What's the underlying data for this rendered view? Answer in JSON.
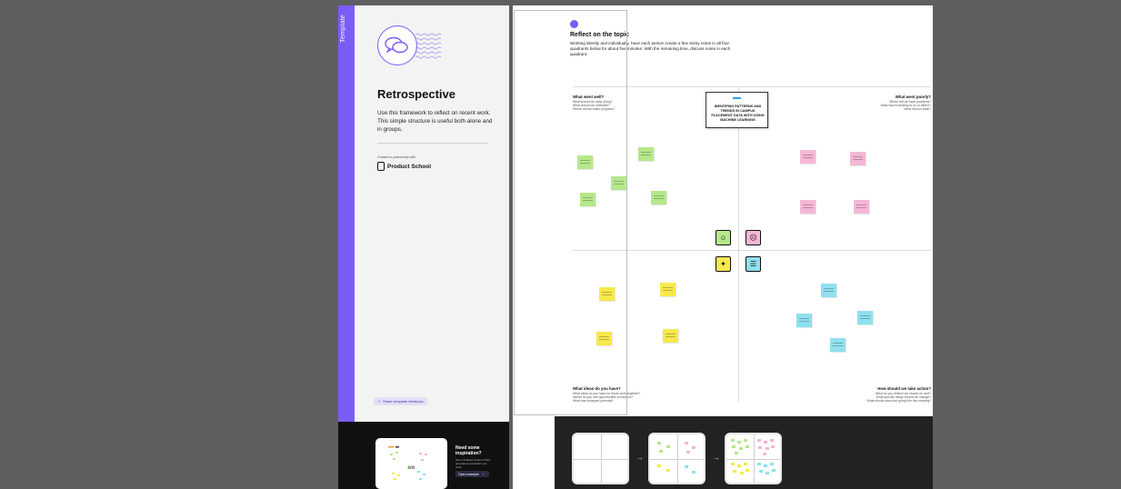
{
  "sidebar": {
    "tag": "Template",
    "title": "Retrospective",
    "description": "Use this framework to reflect on recent work. This simple structure is useful both alone and in groups.",
    "created_in_partnership": "Created in partnership with",
    "partner": "Product School",
    "feedback_label": "Share template feedback",
    "inspiration_title": "Need some inspiration?",
    "inspiration_desc": "See a finished version of this template to jumpstart your work",
    "open_example": "Open example"
  },
  "board": {
    "step_title": "Reflect on the topic",
    "step_desc": "Working silently and individually, have each person create a few sticky notes in all four quadrants below for about five minutes. With the remaining time, discuss notes in each quadrant.",
    "center_card": "IDENTIFING PATTERNS AND TRENDS IN CAMPUS PLACEMENT DATA WITH USING MACHINE LEARNING",
    "quadrants": {
      "went_well": {
        "title": "What went well?",
        "prompts": [
          "What should we keep doing?",
          "What should we celebrate?",
          "Where did we make progress?"
        ]
      },
      "went_poorly": {
        "title": "What went poorly?",
        "prompts": [
          "Where did we have problems?",
          "What was frustrating to us or others?",
          "What held us back?"
        ]
      },
      "ideas": {
        "title": "What ideas do you have?",
        "prompts": [
          "What ideas do you have for future work together?",
          "Where do you see opportunities to improve?",
          "What has untapped potential?"
        ]
      },
      "actions": {
        "title": "How should we take action?",
        "prompts": [
          "What do you believe we should do next?",
          "What specific things should we change?",
          "What should stand out going into this meeting?"
        ]
      }
    }
  },
  "colors": {
    "accent": "#7b5cf6",
    "sticky_green": "#b5e88a",
    "sticky_pink": "#f5b7d6",
    "sticky_yellow": "#f7e94b",
    "sticky_blue": "#8fe0ef"
  }
}
